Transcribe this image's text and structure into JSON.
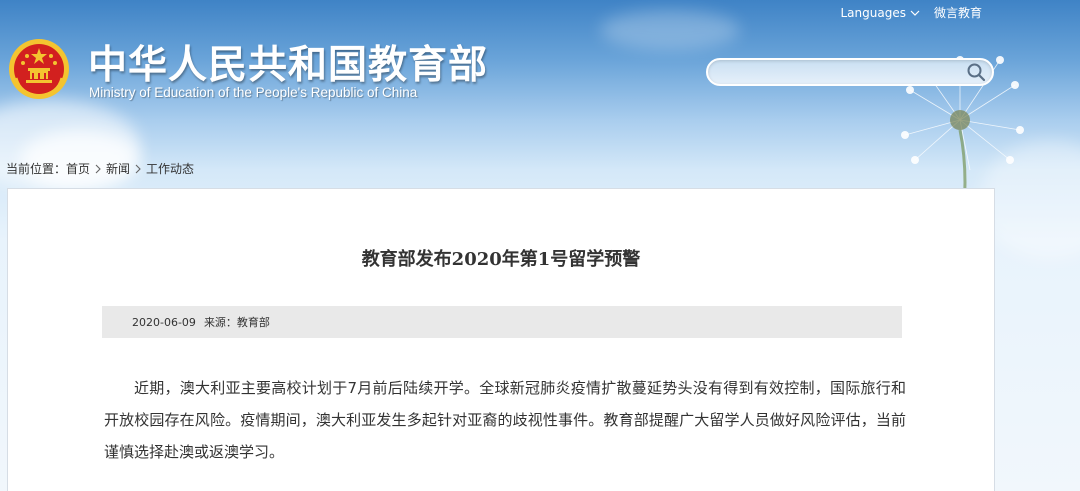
{
  "header": {
    "title_cn": "中华人民共和国教育部",
    "title_en": "Ministry of Education of the People's Republic of China",
    "links": {
      "languages": "Languages",
      "weixin": "微言教育"
    },
    "search": {
      "placeholder": "",
      "value": ""
    }
  },
  "breadcrumb": {
    "prefix": "当前位置：",
    "items": [
      "首页",
      "新闻",
      "工作动态"
    ]
  },
  "article": {
    "title": "教育部发布2020年第1号留学预警",
    "date": "2020-06-09",
    "source": "来源：教育部",
    "body": "近期，澳大利亚主要高校计划于7月前后陆续开学。全球新冠肺炎疫情扩散蔓延势头没有得到有效控制，国际旅行和开放校园存在风险。疫情期间，澳大利亚发生多起针对亚裔的歧视性事件。教育部提醒广大留学人员做好风险评估，当前谨慎选择赴澳或返澳学习。"
  },
  "icons": {
    "emblem": "national-emblem-icon",
    "search": "search-icon",
    "chevron": "chevron-down-icon",
    "breadcrumb_separator": "chevron-right-icon"
  },
  "colors": {
    "header_sky": "#3f83c6",
    "emblem_red": "#d2201f",
    "emblem_gold": "#f4c430",
    "meta_bar": "#e9e9e9",
    "text": "#333333"
  }
}
